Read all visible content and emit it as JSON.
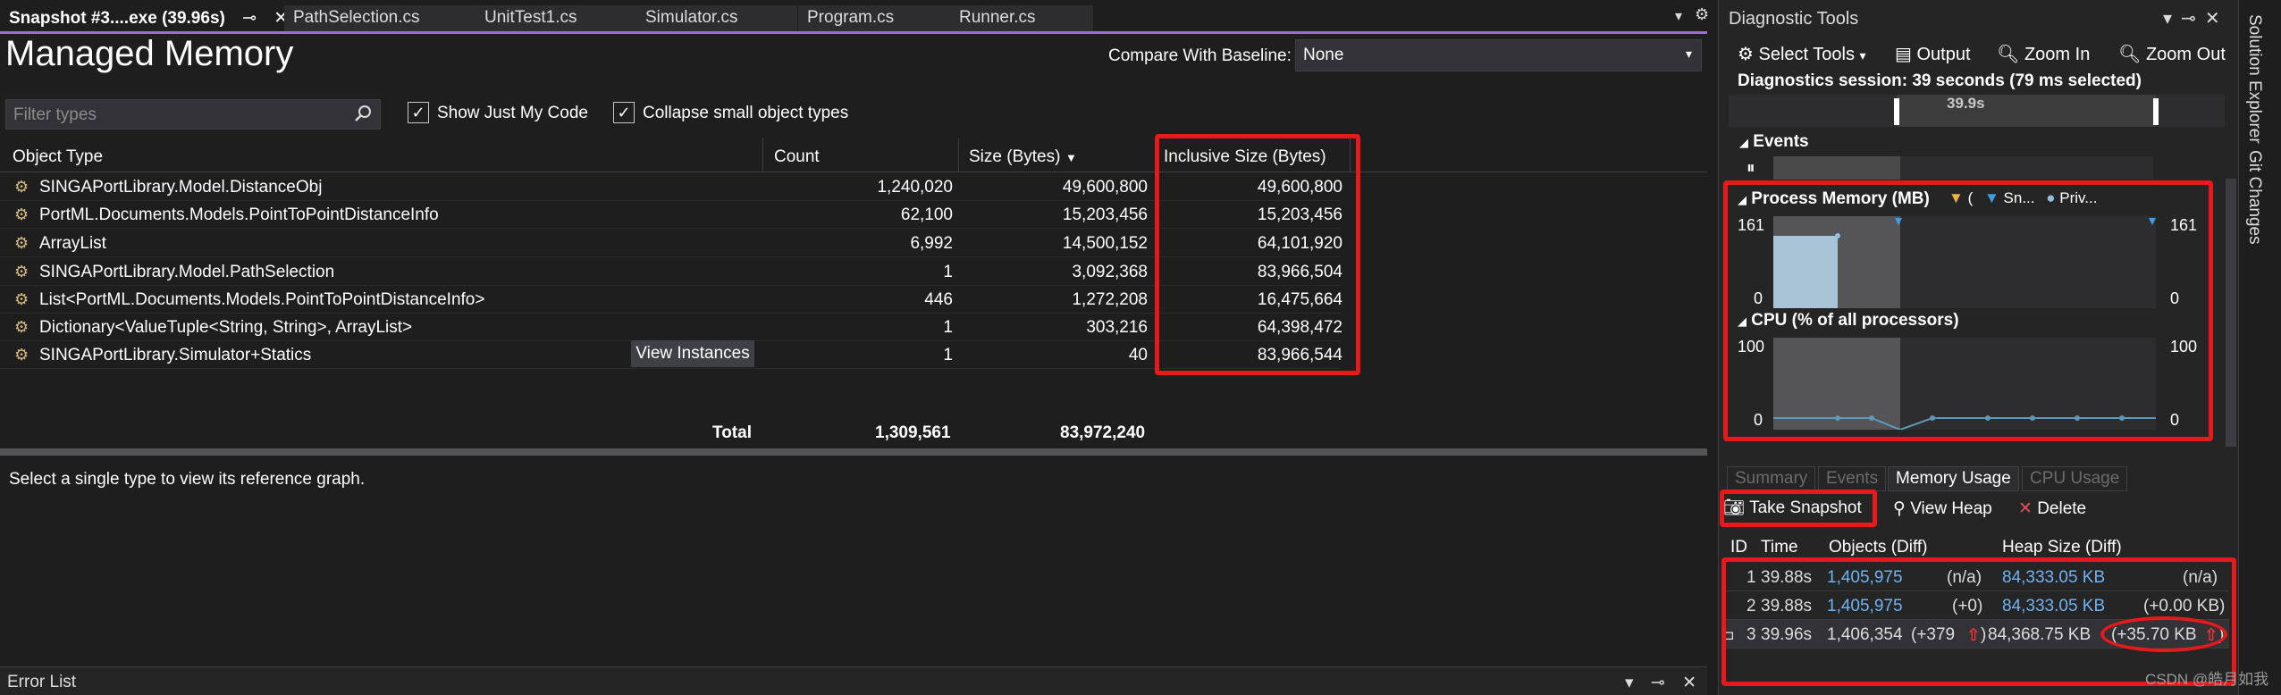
{
  "doc_tabs": [
    {
      "label": "Snapshot #3....exe (39.96s)",
      "active": true
    },
    {
      "label": "PathSelection.cs"
    },
    {
      "label": "UnitTest1.cs"
    },
    {
      "label": "Simulator.cs"
    },
    {
      "label": "Program.cs"
    },
    {
      "label": "Runner.cs"
    }
  ],
  "managed_memory": {
    "title": "Managed Memory",
    "baseline_label": "Compare With Baseline:",
    "baseline_value": "None",
    "filter_placeholder": "Filter types",
    "show_just_my_code": "Show Just My Code",
    "collapse_small": "Collapse small object types",
    "columns": {
      "type": "Object Type",
      "count": "Count",
      "size": "Size (Bytes)",
      "inclusive": "Inclusive Size (Bytes)"
    },
    "rows": [
      {
        "type": "SINGAPortLibrary.Model.DistanceObj",
        "count": "1,240,020",
        "size": "49,600,800",
        "inclusive": "49,600,800"
      },
      {
        "type": "PortML.Documents.Models.PointToPointDistanceInfo",
        "count": "62,100",
        "size": "15,203,456",
        "inclusive": "15,203,456"
      },
      {
        "type": "ArrayList",
        "count": "6,992",
        "size": "14,500,152",
        "inclusive": "64,101,920"
      },
      {
        "type": "SINGAPortLibrary.Model.PathSelection",
        "count": "1",
        "size": "3,092,368",
        "inclusive": "83,966,504"
      },
      {
        "type": "List<PortML.Documents.Models.PointToPointDistanceInfo>",
        "count": "446",
        "size": "1,272,208",
        "inclusive": "16,475,664"
      },
      {
        "type": "Dictionary<ValueTuple<String, String>, ArrayList>",
        "count": "1",
        "size": "303,216",
        "inclusive": "64,398,472"
      },
      {
        "type": "SINGAPortLibrary.Simulator+Statics",
        "count": "1",
        "size": "40",
        "inclusive": "83,966,544"
      }
    ],
    "view_instances": "View Instances",
    "total_label": "Total",
    "total_count": "1,309,561",
    "total_size": "83,972,240",
    "reference_msg": "Select a single type to view its reference graph."
  },
  "error_list": {
    "title": "Error List"
  },
  "diagnostic_tools": {
    "title": "Diagnostic Tools",
    "select_tools": "Select Tools",
    "output": "Output",
    "zoom_in": "Zoom In",
    "zoom_out": "Zoom Out",
    "session": "Diagnostics session: 39 seconds (79 ms selected)",
    "ruler_label": "39.9s",
    "events_label": "Events",
    "process_memory": {
      "label": "Process Memory (MB)",
      "legend_snap": "Sn...",
      "legend_priv": "Priv...",
      "ymax": "161",
      "ymin": "0"
    },
    "cpu": {
      "label": "CPU (% of all processors)",
      "ymax": "100",
      "ymin": "0"
    },
    "bottom_tabs": [
      "Summary",
      "Events",
      "Memory Usage",
      "CPU Usage"
    ],
    "take_snapshot": "Take Snapshot",
    "view_heap": "View Heap",
    "delete": "Delete",
    "snap_columns": {
      "id": "ID",
      "time": "Time",
      "objects": "Objects (Diff)",
      "heap": "Heap Size (Diff)"
    },
    "snapshots": [
      {
        "id": "1",
        "time": "39.88s",
        "objects": "1,405,975",
        "obj_diff": "(n/a)",
        "heap": "84,333.05 KB",
        "heap_diff": "(n/a)"
      },
      {
        "id": "2",
        "time": "39.88s",
        "objects": "1,405,975",
        "obj_diff": "(+0)",
        "heap": "84,333.05 KB",
        "heap_diff": "(+0.00 KB)"
      },
      {
        "id": "3",
        "time": "39.96s",
        "objects": "1,406,354",
        "obj_diff": "(+379",
        "heap": "84,368.75 KB",
        "heap_diff": "(+35.70 KB"
      }
    ]
  },
  "side_tabs": [
    "Solution Explorer",
    "Git Changes"
  ],
  "watermark": "CSDN @皓月如我",
  "colors": {
    "accent": "#9b6cd6",
    "annotation": "#e8191b",
    "link": "#6fb3f2"
  }
}
